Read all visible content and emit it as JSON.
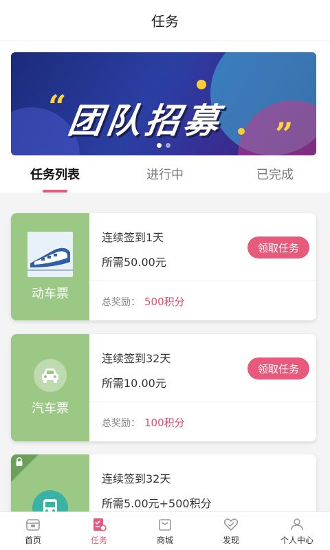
{
  "header": {
    "title": "任务"
  },
  "banner": {
    "headline": "团队招募",
    "quote_open": "“",
    "quote_close": "”"
  },
  "tabs": [
    {
      "label": "任务列表",
      "active": true
    },
    {
      "label": "进行中",
      "active": false
    },
    {
      "label": "已完成",
      "active": false
    }
  ],
  "tasks": [
    {
      "category": "动车票",
      "icon": "train-icon",
      "title": "连续签到1天",
      "requirement": "所需50.00元",
      "button": "领取任务",
      "reward_label": "总奖励：",
      "reward_value": "500积分",
      "locked": false
    },
    {
      "category": "汽车票",
      "icon": "car-icon",
      "title": "连续签到32天",
      "requirement": "所需10.00元",
      "button": "领取任务",
      "reward_label": "总奖励：",
      "reward_value": "100积分",
      "locked": false
    },
    {
      "category": "",
      "icon": "bus-icon",
      "title": "连续签到32天",
      "requirement": "所需5.00元+500积分",
      "locked": true
    }
  ],
  "bottom_nav": [
    {
      "label": "首页",
      "icon": "home-icon",
      "active": false
    },
    {
      "label": "任务",
      "icon": "task-icon",
      "active": true
    },
    {
      "label": "商城",
      "icon": "shop-icon",
      "active": false
    },
    {
      "label": "发现",
      "icon": "discover-icon",
      "active": false
    },
    {
      "label": "个人中心",
      "icon": "profile-icon",
      "active": false
    }
  ],
  "colors": {
    "accent": "#e75a7c",
    "card_left": "#9bc884",
    "reward": "#e34a6f"
  }
}
